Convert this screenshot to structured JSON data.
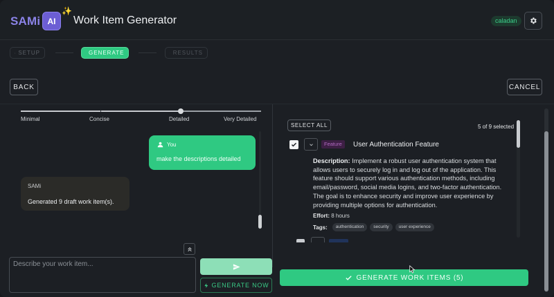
{
  "header": {
    "brand": "SAMi",
    "ai_badge": "AI",
    "sparkle": "✨",
    "title": "Work Item Generator",
    "user_chip": "caladan",
    "settings_icon": "gear-icon"
  },
  "stepper": {
    "steps": [
      {
        "label": "SETUP",
        "icon": "gear-icon",
        "state": "done"
      },
      {
        "label": "GENERATE",
        "icon": "chat-icon",
        "state": "active"
      },
      {
        "label": "RESULTS",
        "icon": "list-icon",
        "state": "pending"
      }
    ]
  },
  "actions": {
    "back_label": "BACK",
    "cancel_label": "CANCEL"
  },
  "detail_slider": {
    "labels": [
      "Minimal",
      "Concise",
      "Detailed",
      "Very Detailed"
    ],
    "selected": "Detailed"
  },
  "chat": {
    "messages": [
      {
        "role": "user",
        "author": "You",
        "text": "make the descriptions detailed"
      },
      {
        "role": "assistant",
        "author": "SAMi",
        "text": "Generated 9 draft work item(s)."
      }
    ],
    "input_placeholder": "Describe your work item...",
    "collapse_icon": "double-chevron-up-icon",
    "send_icon": "send-icon",
    "generate_now_label": "GENERATE NOW",
    "generate_now_icon": "bolt-icon"
  },
  "results": {
    "select_all_label": "SELECT ALL",
    "selection_count": "5 of 9 selected",
    "items": [
      {
        "checked": true,
        "type": "Feature",
        "title": "User Authentication Feature",
        "description_label": "Description:",
        "description": "Implement a robust user authentication system that allows users to securely log in and log out of the application. This feature should support various authentication methods, including email/password, social media logins, and two-factor authentication. The goal is to enhance security and improve user experience by providing multiple options for authentication.",
        "effort_label": "Effort:",
        "effort": "8 hours",
        "tags_label": "Tags:",
        "tags": [
          "authentication",
          "security",
          "user experience"
        ]
      }
    ],
    "generate_button_label": "GENERATE WORK ITEMS (5)",
    "generate_button_icon": "check-icon"
  },
  "colors": {
    "accent_green": "#2fc982",
    "brand_purple": "#8b83e8",
    "feature_badge": "#3d1f44",
    "background": "#1c1f24"
  }
}
